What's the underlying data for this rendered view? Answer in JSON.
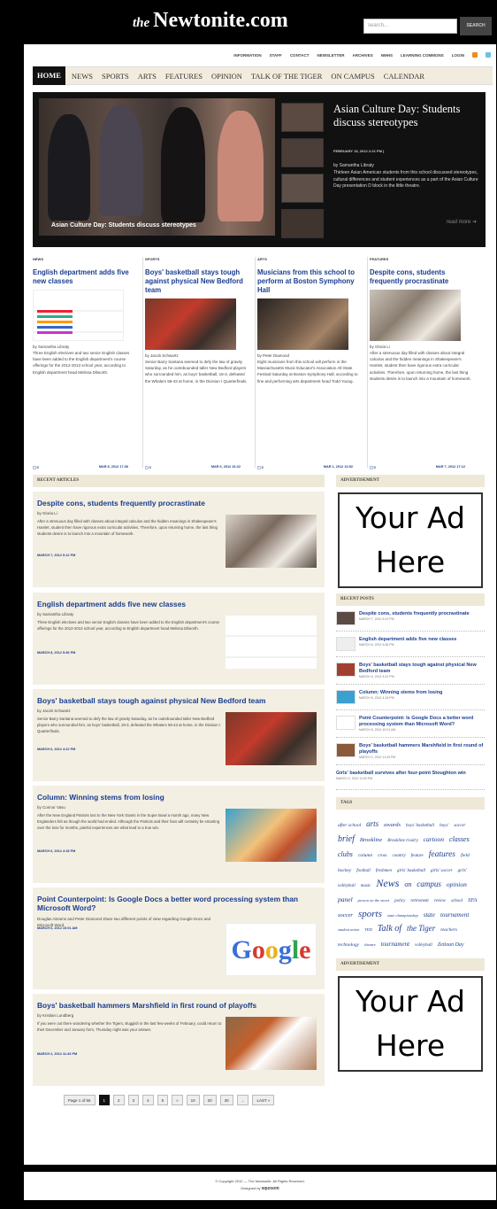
{
  "header": {
    "logo_the": "the",
    "logo_name": "Newtonite.com",
    "search_placeholder": "search...",
    "search_button": "SEARCH"
  },
  "top_nav": [
    "INFORMATION",
    "STAFF",
    "CONTACT",
    "NEWSLETTER",
    "ARCHIVES",
    "NMHS",
    "LEARNING COMMONS",
    "LOGIN"
  ],
  "main_nav": {
    "active": "Home",
    "items": [
      "News",
      "Sports",
      "Arts",
      "Features",
      "Opinion",
      "Talk of the Tiger",
      "On Campus",
      "Calendar"
    ]
  },
  "slider": {
    "caption": "Asian Culture Day: Students discuss stereotypes",
    "title": "Asian Culture Day: Students discuss stereotypes",
    "date": "FEBRUARY 15, 2012 2:21 PM |",
    "byline": "by Samantha Libraty",
    "text": "Thirteen Asian American students from this school discussed stereotypes, cultural differences and student experiences as a part of the Asian Culture Day presentation D block in the little theatre.",
    "more": "read more"
  },
  "featured": [
    {
      "category": "NEWS",
      "title": "English department adds five new classes",
      "byline": "by Samantha Libraty",
      "text": "Three English electives and two senior English classes have been added to the English department's course offerings for the 2012-2013 school year, according to English department head Melissa Dilworth.",
      "comments": "0",
      "date": "MAR 8, 2012 17:36"
    },
    {
      "category": "SPORTS",
      "title": "Boys' basketball stays tough against physical New Bedford team",
      "byline": "by Jacob Schwartz",
      "text": "Senior Barry Santana seemed to defy the law of gravity Saturday, as he outrebounded taller New Bedford players who surrounded him, as boys' basketball, 18-3, defeated the Whalers 58-43 at home, in the Division I Quarterfinals.",
      "comments": "0",
      "date": "MAR 6, 2012 16:22"
    },
    {
      "category": "ARTS",
      "title": "Musicians from this school to perform at Boston Symphony Hall",
      "byline": "by Peter Diamond",
      "text": "Eight musicians from this school will perform in the Massachusetts Music Educator's Association All-State Festival Saturday at Boston Symphony Hall, according to fine and performing arts department head Todd Young.",
      "comments": "0",
      "date": "MAR 1, 2012 13:52"
    },
    {
      "category": "FEATURES",
      "title": "Despite cons, students frequently procrastinate",
      "byline": "by Gloria Li",
      "text": "After a strenuous day filled with classes about integral calculus and the hidden meanings in Shakespeare's Hamlet, student then have rigorous extra curricular activities. Therefore, upon returning home, the last thing students desire is to launch into a mountain of homework.",
      "comments": "0",
      "date": "MAR 7, 2012 17:12"
    }
  ],
  "recent_header": "RECENT ARTICLES",
  "recent_articles": [
    {
      "title": "Despite cons, students frequently procrastinate",
      "byline": "by Gloria Li",
      "text": "After a strenuous day filled with classes about integral calculus and the hidden meanings in Shakespeare's Hamlet, student then have rigorous extra curricular activities. Therefore, upon returning home, the last thing students desire is to launch into a mountain of homework.",
      "date": "MARCH 7, 2012 5:12 PM"
    },
    {
      "title": "English department adds five new classes",
      "byline": "by Samantha Libraty",
      "text": "Three English electives and two senior English classes have been added to the English department's course offerings for the 2012-2013 school year, according to English department head Melissa Dilworth.",
      "date": "MARCH 8, 2012 5:36 PM"
    },
    {
      "title": "Boys' basketball stays tough against physical New Bedford team",
      "byline": "by Jacob Schwartz",
      "text": "Senior Barry Santana seemed to defy the law of gravity Saturday, as he outrebounded taller New Bedford players who surrounded him, as boys' basketball, 18-3, defeated the Whalers 58-43 at home, in the Division I Quarterfinals.",
      "date": "MARCH 6, 2012 4:22 PM"
    },
    {
      "title": "Column: Winning stems from losing",
      "byline": "by Connor Vasu",
      "text": "After the New England Patriots lost to the New York Giants in the Super Bowl a month ago, many New Englanders felt as though the world had ended. Although the Patriots and their fans will certainly be smarting over the loss for months, painful experiences are what lead to a true win.",
      "date": "MARCH 6, 2012 4:18 PM"
    },
    {
      "title": "Point Counterpoint: Is Google Docs a better word processing system than Microsoft Word?",
      "byline": "Douglas Abrams and Peter Diamond share two different points of view regarding Google Docs and Microsoft Word.",
      "text": "",
      "date": "MARCH 6, 2012 10:01 AM"
    },
    {
      "title": "Boys' basketball hammers Marshfield in first round of playoffs",
      "byline": "by Kristian Lundberg",
      "text": "If you were out there wondering whether the Tigers, sluggish in the last few weeks of February, could return to their December and January form, Thursday night was your answer.",
      "date": "MARCH 2, 2012 11:43 PM"
    }
  ],
  "pager": {
    "label": "Page 1 of 56",
    "current": "1",
    "pages": [
      "2",
      "3",
      "4",
      "5",
      "»",
      "10",
      "20",
      "30",
      "..."
    ],
    "last": "LAST »"
  },
  "sidebar": {
    "ad_header": "ADVERTISEMENT",
    "ad_text_1": "Your Ad",
    "ad_text_2": "Here",
    "recent_posts_header": "RECENT POSTS",
    "recent_posts": [
      {
        "title": "Despite cons, students frequently procrastinate",
        "date": "MARCH 7, 2012 5:12 PM"
      },
      {
        "title": "English department adds five new classes",
        "date": "MARCH 8, 2012 5:36 PM"
      },
      {
        "title": "Boys' basketball stays tough against physical New Bedford team",
        "date": "MARCH 6, 2012 4:22 PM"
      },
      {
        "title": "Column: Winning stems from losing",
        "date": "MARCH 6, 2012 4:18 PM"
      },
      {
        "title": "Point Counterpoint: Is Google Docs a better word processing system than Microsoft Word?",
        "date": "MARCH 6, 2012 10:01 AM"
      },
      {
        "title": "Boys' basketball hammers Marshfield in first round of playoffs",
        "date": "MARCH 2, 2012 11:43 PM"
      },
      {
        "title": "Girls' basketball survives after four-point Stoughton win",
        "date": "MARCH 2, 2012 11:00 PM"
      }
    ],
    "tags_header": "TAGS",
    "tags": [
      {
        "t": "after school",
        "s": 5.5
      },
      {
        "t": "arts",
        "s": 9
      },
      {
        "t": "awards",
        "s": 6.5
      },
      {
        "t": "boys' basketball",
        "s": 5
      },
      {
        "t": "boys'",
        "s": 5
      },
      {
        "t": "soccer",
        "s": 5
      },
      {
        "t": "brief",
        "s": 10
      },
      {
        "t": "Brookline",
        "s": 6.5
      },
      {
        "t": "Brookline rivalry",
        "s": 5
      },
      {
        "t": "cartoon",
        "s": 7.5
      },
      {
        "t": "classes",
        "s": 8
      },
      {
        "t": "clubs",
        "s": 8
      },
      {
        "t": "column",
        "s": 5.5
      },
      {
        "t": "cross",
        "s": 5
      },
      {
        "t": "country",
        "s": 5
      },
      {
        "t": "feature",
        "s": 5
      },
      {
        "t": "features",
        "s": 9.5
      },
      {
        "t": "field hockey",
        "s": 5.5
      },
      {
        "t": "football",
        "s": 5
      },
      {
        "t": "freshmen",
        "s": 5
      },
      {
        "t": "girls' basketball",
        "s": 5
      },
      {
        "t": "girls' soccer",
        "s": 5
      },
      {
        "t": "girls' volleyball",
        "s": 5
      },
      {
        "t": "music",
        "s": 5
      },
      {
        "t": "News",
        "s": 12
      },
      {
        "t": "on",
        "s": 8
      },
      {
        "t": "campus",
        "s": 9
      },
      {
        "t": "opinion",
        "s": 7.5
      },
      {
        "t": "panel",
        "s": 7.5
      },
      {
        "t": "person on the street",
        "s": 4.5
      },
      {
        "t": "policy",
        "s": 5
      },
      {
        "t": "retirement",
        "s": 5
      },
      {
        "t": "review",
        "s": 5
      },
      {
        "t": "school",
        "s": 5
      },
      {
        "t": "SFA",
        "s": 6.5
      },
      {
        "t": "soccer",
        "s": 6.5
      },
      {
        "t": "sports",
        "s": 11
      },
      {
        "t": "state championship",
        "s": 4.5
      },
      {
        "t": "state",
        "s": 7
      },
      {
        "t": "tournament",
        "s": 7
      },
      {
        "t": "student union",
        "s": 4.5
      },
      {
        "t": "TED",
        "s": 4.5
      },
      {
        "t": "Talk of",
        "s": 10
      },
      {
        "t": "the Tiger",
        "s": 9
      },
      {
        "t": "teachers",
        "s": 5.5
      },
      {
        "t": "technology",
        "s": 5.5
      },
      {
        "t": "theatre",
        "s": 4.5
      },
      {
        "t": "tournament",
        "s": 7
      },
      {
        "t": "volleyball",
        "s": 5
      },
      {
        "t": "Zeitoun Day",
        "s": 6
      }
    ],
    "ad2_header": "ADVERTISEMENT"
  },
  "footer": {
    "copyright": "© Copyright 2012 — The Newtonite. All Rights Reserved.",
    "designed_by": "Designed by",
    "designer": "wpzoom"
  },
  "colors": {
    "link": "#1a3d8f",
    "nav_bg": "#f1ecdd",
    "box_bg": "#f3efe3",
    "accent": "#111111"
  }
}
